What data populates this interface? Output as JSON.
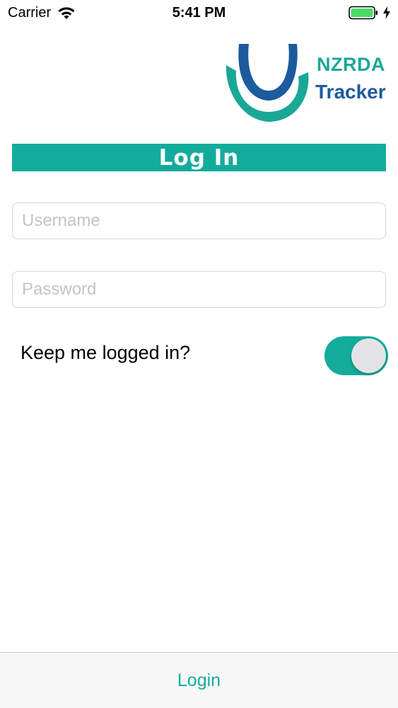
{
  "status_bar": {
    "carrier": "Carrier",
    "time": "5:41 PM",
    "wifi_icon": "wifi-icon",
    "battery_icon": "battery-icon",
    "charging_icon": "bolt-icon"
  },
  "logo": {
    "line1": "NZRDA",
    "line2": "Tracker",
    "colors": {
      "teal": "#1aa896",
      "blue": "#1c5b9e"
    }
  },
  "header": {
    "title": "Log In",
    "color": "#13ac9c"
  },
  "form": {
    "username": {
      "value": "",
      "placeholder": "Username"
    },
    "password": {
      "value": "",
      "placeholder": "Password"
    },
    "keep_logged_in": {
      "label": "Keep me logged in?",
      "checked": true
    }
  },
  "toolbar": {
    "login_label": "Login"
  },
  "theme": {
    "accent": "#13ac9c"
  }
}
